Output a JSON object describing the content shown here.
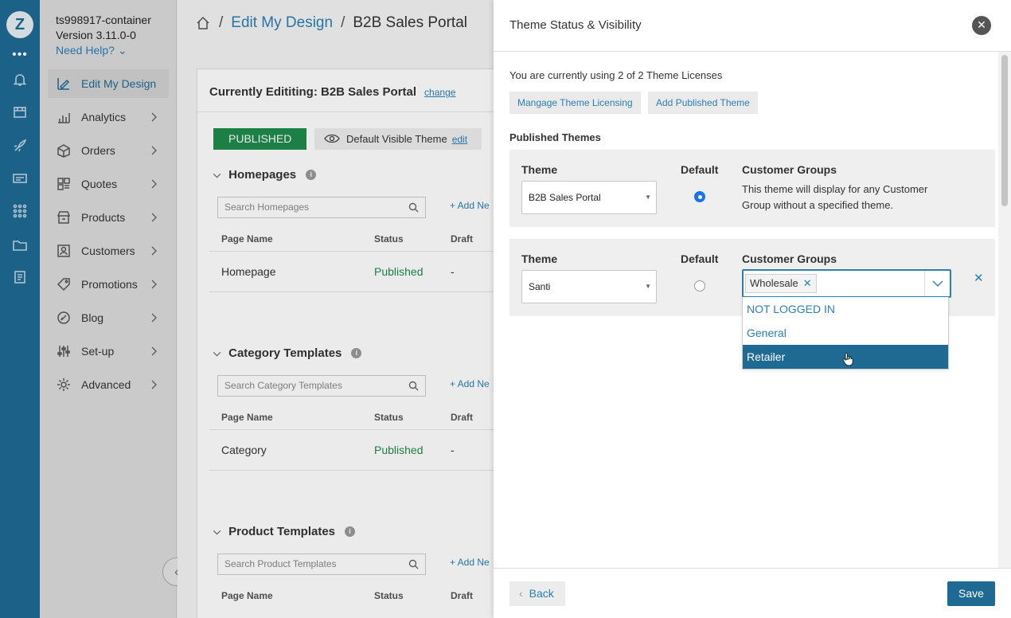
{
  "account": {
    "name": "ts998917-container",
    "version": "Version 3.11.0-0",
    "help": "Need Help?"
  },
  "nav": {
    "items": [
      {
        "label": "Edit My Design",
        "icon": "design-icon"
      },
      {
        "label": "Analytics",
        "icon": "analytics-icon"
      },
      {
        "label": "Orders",
        "icon": "orders-icon"
      },
      {
        "label": "Quotes",
        "icon": "quotes-icon"
      },
      {
        "label": "Products",
        "icon": "products-icon"
      },
      {
        "label": "Customers",
        "icon": "customers-icon"
      },
      {
        "label": "Promotions",
        "icon": "promotions-icon"
      },
      {
        "label": "Blog",
        "icon": "blog-icon"
      },
      {
        "label": "Set-up",
        "icon": "setup-icon"
      },
      {
        "label": "Advanced",
        "icon": "advanced-icon"
      }
    ]
  },
  "breadcrumb": {
    "sep": "/",
    "link": "Edit My Design",
    "current": "B2B Sales Portal"
  },
  "main": {
    "editing": "Currently Edititing: B2B Sales Portal",
    "change": "change",
    "published": "PUBLISHED",
    "visible_theme": "Default Visible Theme",
    "edit": "edit",
    "add_new": "+ Add Ne",
    "col_page": "Page Name",
    "col_status": "Status",
    "col_draft": "Draft",
    "sections": [
      {
        "title": "Homepages",
        "search": "Search Homepages",
        "row": {
          "name": "Homepage",
          "status": "Published",
          "draft": "-"
        }
      },
      {
        "title": "Category Templates",
        "search": "Search Category Templates",
        "row": {
          "name": "Category",
          "status": "Published",
          "draft": "-"
        }
      },
      {
        "title": "Product Templates",
        "search": "Search Product Templates"
      }
    ]
  },
  "modal": {
    "title": "Theme Status & Visibility",
    "license_text": "You are currently using 2 of 2 Theme Licenses",
    "manage_btn": "Mangage Theme Licensing",
    "add_btn": "Add Published Theme",
    "published_heading": "Published Themes",
    "col_theme": "Theme",
    "col_default": "Default",
    "col_groups": "Customer Groups",
    "themes": [
      {
        "theme": "B2B Sales Portal",
        "default": true,
        "groups_text": "This theme will display for any Customer Group without a specified theme."
      },
      {
        "theme": "Santi",
        "default": false,
        "chip": "Wholesale"
      }
    ],
    "dropdown_options": [
      "NOT LOGGED IN",
      "General",
      "Retailer"
    ],
    "back": "Back",
    "save": "Save"
  },
  "colors": {
    "rail": "#1f6a93",
    "accent": "#2a7fb4",
    "published": "#1e8a4c",
    "highlight": "#1f6a93"
  }
}
